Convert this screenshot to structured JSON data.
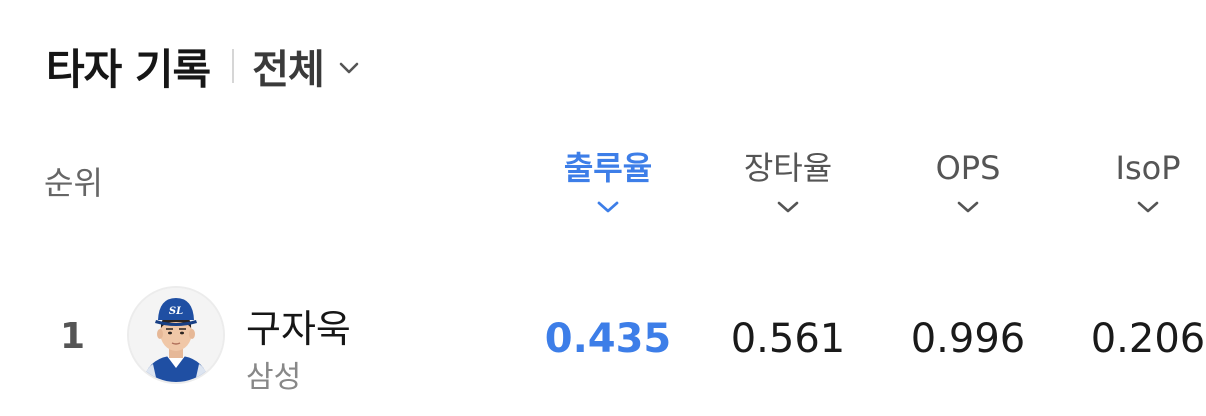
{
  "header": {
    "title": "타자 기록",
    "filter_label": "전체",
    "filter_icon": "chevron-down-icon"
  },
  "columns": {
    "rank_label": "순위",
    "stats": [
      {
        "label": "출루율",
        "active": true,
        "icon": "chevron-down-icon"
      },
      {
        "label": "장타율",
        "active": false,
        "icon": "chevron-down-icon"
      },
      {
        "label": "OPS",
        "active": false,
        "icon": "chevron-down-icon"
      },
      {
        "label": "IsoP",
        "active": false,
        "icon": "chevron-down-icon"
      }
    ]
  },
  "rows": [
    {
      "rank": "1",
      "name": "구자욱",
      "team": "삼성",
      "values": [
        "0.435",
        "0.561",
        "0.996",
        "0.206"
      ]
    }
  ],
  "colors": {
    "accent": "#3d7ee8",
    "text": "#1a1a1a",
    "muted": "#888888"
  }
}
